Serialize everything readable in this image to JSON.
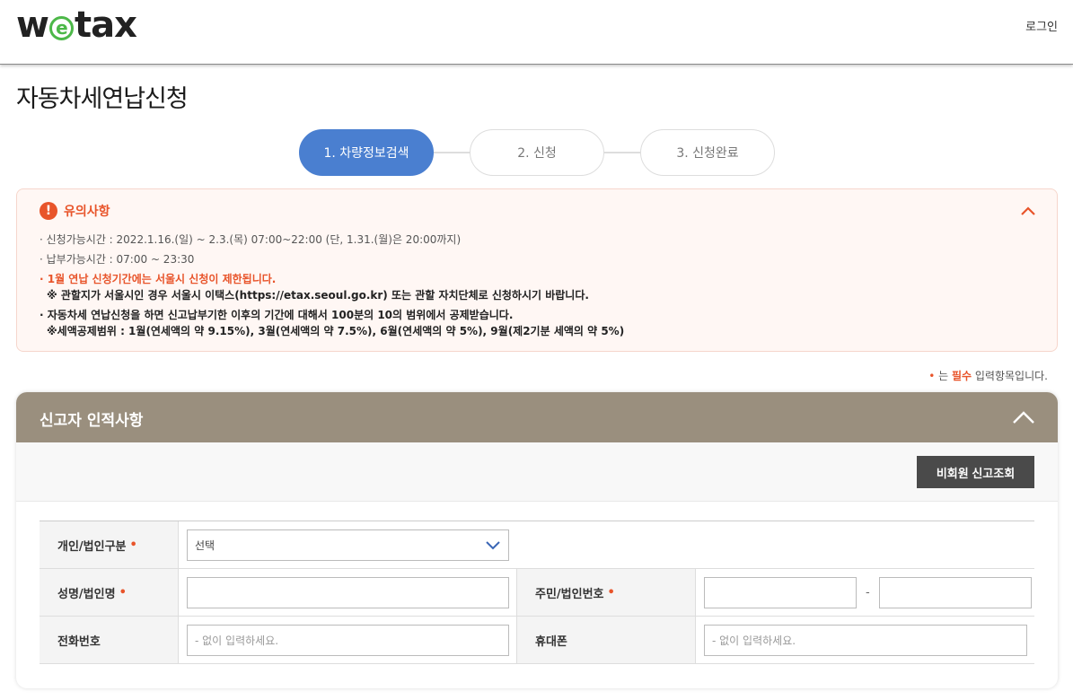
{
  "header": {
    "logo_left": "w",
    "logo_e": "e",
    "logo_right": "tax",
    "login": "로그인"
  },
  "page": {
    "title": "자동차세연납신청"
  },
  "steps": [
    {
      "label": "1. 차량정보검색",
      "active": true
    },
    {
      "label": "2. 신청",
      "active": false
    },
    {
      "label": "3. 신청완료",
      "active": false
    }
  ],
  "notice": {
    "title": "유의사항",
    "items": [
      "· 신청가능시간 : 2022.1.16.(일) ~ 2.3.(목) 07:00~22:00 (단, 1.31.(월)은 20:00까지)",
      "· 납부가능시간 : 07:00 ~ 23:30"
    ],
    "warning_line1": "· 1월 연납 신청기간에는 서울시 신청이 제한됩니다.",
    "warning_line2": "※ 관할지가 서울시인 경우 서울시 이택스(https://etax.seoul.go.kr) 또는 관할 자치단체로 신청하시기 바랍니다.",
    "deduct_line1": "· 자동차세 연납신청을 하면 신고납부기한 이후의 기간에 대해서 100분의 10의 범위에서 공제받습니다.",
    "deduct_line2": "※세액공제범위 : 1월(연세액의 약 9.15%), 3월(연세액의 약 7.5%), 6월(연세액의 약 5%), 9월(제2기분 세액의 약 5%)"
  },
  "required_note": {
    "dot": "•",
    "prefix": "는 ",
    "must": "필수",
    "suffix": " 입력항목입니다."
  },
  "panel": {
    "title": "신고자 인적사항",
    "lookup_button": "비회원 신고조회",
    "fields": {
      "type_label": "개인/법인구분",
      "type_value": "선택",
      "name_label": "성명/법인명",
      "id_label": "주민/법인번호",
      "id_dash": "-",
      "phone_label": "전화번호",
      "phone_placeholder": "- 없이 입력하세요.",
      "mobile_label": "휴대폰",
      "mobile_placeholder": "- 없이 입력하세요.",
      "required_mark": "•"
    }
  },
  "colors": {
    "accent_blue": "#4a7fd0",
    "warn_orange": "#e8542a",
    "panel_header": "#9a8f7e",
    "logo_green": "#4cb848"
  }
}
